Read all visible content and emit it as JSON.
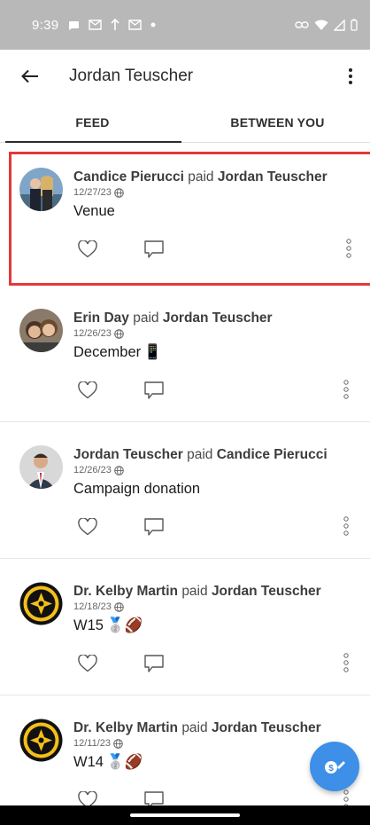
{
  "status_bar": {
    "time": "9:39",
    "left_icons": [
      "chat-bubble-icon",
      "gmail-icon",
      "upload-icon",
      "gmail-icon",
      "dot-icon"
    ],
    "right_icons": [
      "link-icon",
      "wifi-icon",
      "signal-icon",
      "battery-icon"
    ]
  },
  "app_bar": {
    "title": "Jordan Teuscher"
  },
  "tabs": [
    {
      "label": "FEED",
      "active": true
    },
    {
      "label": "BETWEEN YOU",
      "active": false
    }
  ],
  "feed": [
    {
      "payer": "Candice Pierucci",
      "verb": "paid",
      "payee": "Jordan Teuscher",
      "date": "12/27/23",
      "note": "Venue",
      "emoji": "",
      "highlighted": true
    },
    {
      "payer": "Erin Day",
      "verb": "paid",
      "payee": "Jordan Teuscher",
      "date": "12/26/23",
      "note": "December",
      "emoji": "📱",
      "highlighted": false
    },
    {
      "payer": "Jordan Teuscher",
      "verb": "paid",
      "payee": "Candice Pierucci",
      "date": "12/26/23",
      "note": "Campaign donation",
      "emoji": "",
      "highlighted": false
    },
    {
      "payer": "Dr. Kelby Martin",
      "verb": "paid",
      "payee": "Jordan Teuscher",
      "date": "12/18/23",
      "note": "W15",
      "emoji": "🥈🏈",
      "highlighted": false
    },
    {
      "payer": "Dr. Kelby Martin",
      "verb": "paid",
      "payee": "Jordan Teuscher",
      "date": "12/11/23",
      "note": "W14",
      "emoji": "🥈🏈",
      "highlighted": false
    }
  ],
  "colors": {
    "status_bar": "#b8b8b8",
    "highlight_border": "#e53838",
    "fab": "#3d8fe8"
  }
}
